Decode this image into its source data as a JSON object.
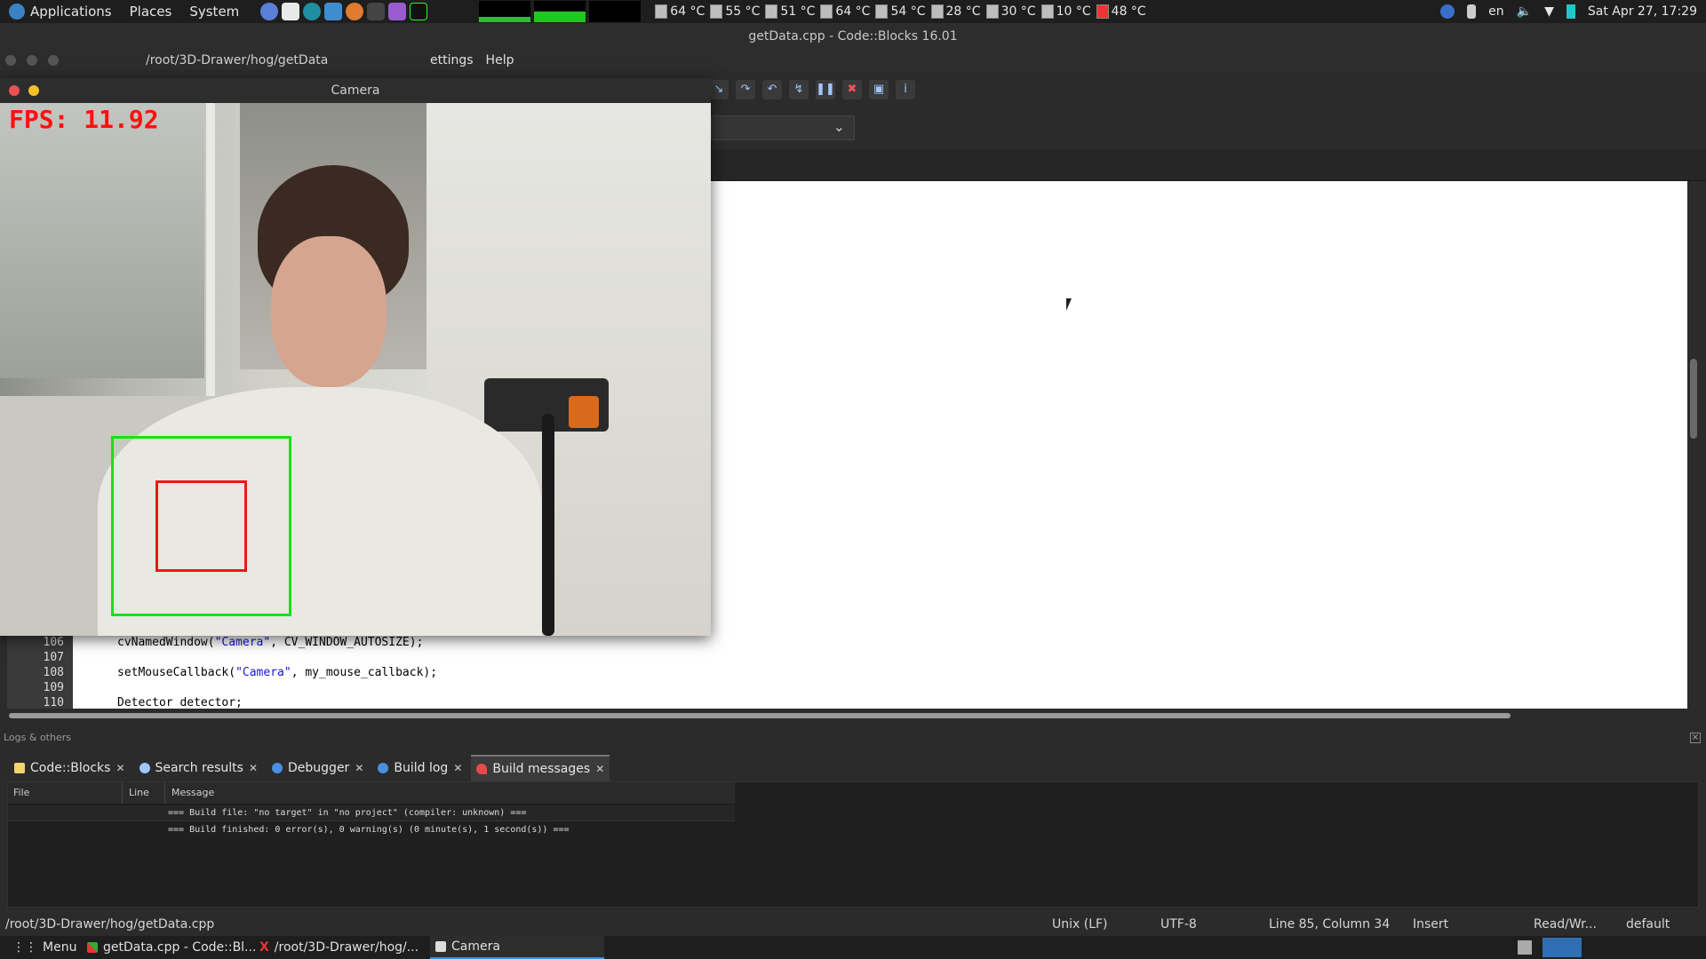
{
  "top_panel": {
    "menus": [
      "Applications",
      "Places",
      "System"
    ],
    "temps": [
      "64 °C",
      "55 °C",
      "51 °C",
      "64 °C",
      "54 °C",
      "28 °C",
      "30 °C",
      "10 °C",
      "48 °C"
    ],
    "lang": "en",
    "clock": "Sat Apr 27, 17:29"
  },
  "cb_window": {
    "title": "getData.cpp - Code::Blocks 16.01",
    "menus_visible": [
      "ettings",
      "Help"
    ]
  },
  "terminal": {
    "title": "/root/3D-Drawer/hog/getData"
  },
  "camera": {
    "title": "Camera",
    "fps": "FPS: 11.92"
  },
  "code": {
    "lines": [
      {
        "num": "106",
        "pre": "cvNamedWindow(",
        "str": "\"Camera\"",
        "post": ", CV_WINDOW_AUTOSIZE);"
      },
      {
        "num": "107",
        "pre": "",
        "str": "",
        "post": ""
      },
      {
        "num": "108",
        "pre": "setMouseCallback(",
        "str": "\"Camera\"",
        "post": ", my_mouse_callback);"
      },
      {
        "num": "109",
        "pre": "",
        "str": "",
        "post": ""
      },
      {
        "num": "110",
        "pre": "Detector detector;",
        "str": "",
        "post": ""
      }
    ]
  },
  "logs": {
    "header": "Logs & others",
    "tabs": [
      "Code::Blocks",
      "Search results",
      "Debugger",
      "Build log",
      "Build messages"
    ],
    "active_tab": "Build messages",
    "columns": [
      "File",
      "Line",
      "Message"
    ],
    "messages": [
      "=== Build file: \"no target\" in \"no project\" (compiler: unknown) ===",
      "=== Build finished: 0 error(s), 0 warning(s) (0 minute(s), 1 second(s)) ==="
    ]
  },
  "statusbar": {
    "path": "/root/3D-Drawer/hog/getData.cpp",
    "eol": "Unix (LF)",
    "encoding": "UTF-8",
    "position": "Line 85, Column 34",
    "mode": "Insert",
    "access": "Read/Wr...",
    "profile": "default"
  },
  "taskbar": {
    "menu": "Menu",
    "tasks": [
      "getData.cpp - Code::Bl...",
      "/root/3D-Drawer/hog/...",
      "Camera"
    ],
    "active_task": "Camera"
  },
  "colors": {
    "fps_text": "#ff1010",
    "detect_outer": "#18e018",
    "detect_inner": "#ee1818",
    "accent": "#3b8fd9"
  }
}
